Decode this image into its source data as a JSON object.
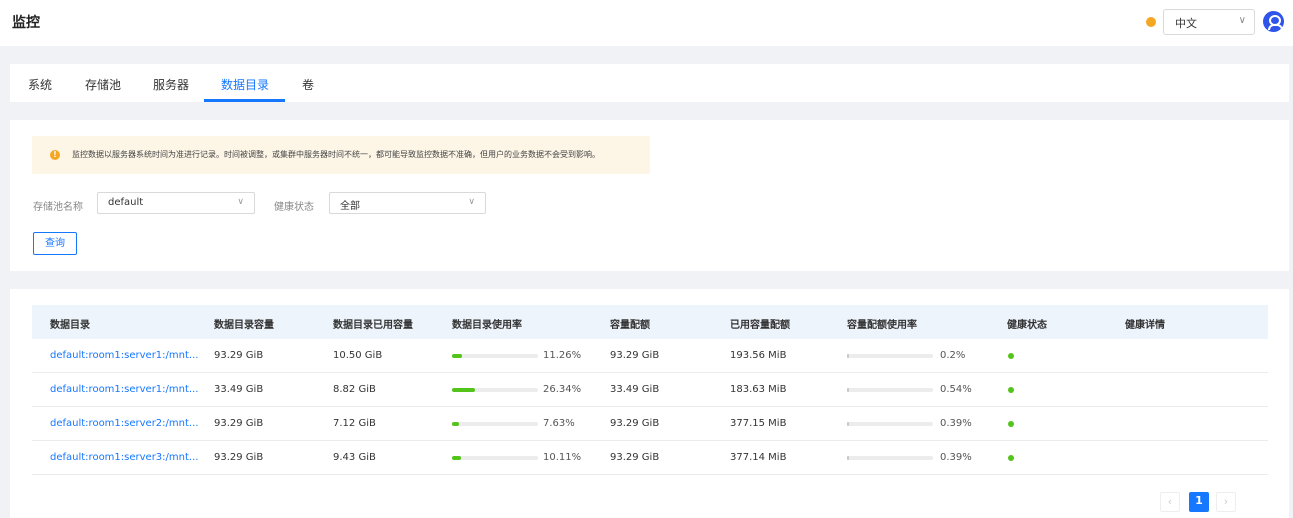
{
  "header": {
    "title": "监控",
    "language": "中文"
  },
  "tabs": [
    {
      "label": "系统"
    },
    {
      "label": "存储池"
    },
    {
      "label": "服务器"
    },
    {
      "label": "数据目录"
    },
    {
      "label": "卷"
    }
  ],
  "active_tab": "数据目录",
  "alert": {
    "text": "监控数据以服务器系统时间为准进行记录。时间被调整，或集群中服务器时间不统一，都可能导致监控数据不准确，但用户的业务数据不会受到影响。"
  },
  "filters": {
    "pool_label": "存储池名称",
    "pool_value": "default",
    "health_label": "健康状态",
    "health_value": "全部",
    "query_label": "查询"
  },
  "table": {
    "columns": [
      "数据目录",
      "数据目录容量",
      "数据目录已用容量",
      "数据目录使用率",
      "容量配额",
      "已用容量配额",
      "容量配额使用率",
      "健康状态",
      "健康详情"
    ],
    "rows": [
      {
        "dir": "default:room1:server1:/mnt...",
        "capacity": "93.29 GiB",
        "used": "10.50 GiB",
        "usage_pct": "11.26%",
        "usage_frac": 0.1126,
        "quota": "93.29 GiB",
        "quota_used": "193.56 MiB",
        "quota_pct": "0.2%",
        "quota_frac": 0.002,
        "health": "healthy",
        "detail": ""
      },
      {
        "dir": "default:room1:server1:/mnt...",
        "capacity": "33.49 GiB",
        "used": "8.82 GiB",
        "usage_pct": "26.34%",
        "usage_frac": 0.2634,
        "quota": "33.49 GiB",
        "quota_used": "183.63 MiB",
        "quota_pct": "0.54%",
        "quota_frac": 0.0054,
        "health": "healthy",
        "detail": ""
      },
      {
        "dir": "default:room1:server2:/mnt...",
        "capacity": "93.29 GiB",
        "used": "7.12 GiB",
        "usage_pct": "7.63%",
        "usage_frac": 0.0763,
        "quota": "93.29 GiB",
        "quota_used": "377.15 MiB",
        "quota_pct": "0.39%",
        "quota_frac": 0.0039,
        "health": "healthy",
        "detail": ""
      },
      {
        "dir": "default:room1:server3:/mnt...",
        "capacity": "93.29 GiB",
        "used": "9.43 GiB",
        "usage_pct": "10.11%",
        "usage_frac": 0.1011,
        "quota": "93.29 GiB",
        "quota_used": "377.14 MiB",
        "quota_pct": "0.39%",
        "quota_frac": 0.0039,
        "health": "healthy",
        "detail": ""
      }
    ]
  },
  "pagination": {
    "prev": "‹",
    "current": "1",
    "next": "›"
  },
  "colors": {
    "accent": "#1677ff",
    "healthy": "#52c41a",
    "warning": "#f5a623"
  }
}
